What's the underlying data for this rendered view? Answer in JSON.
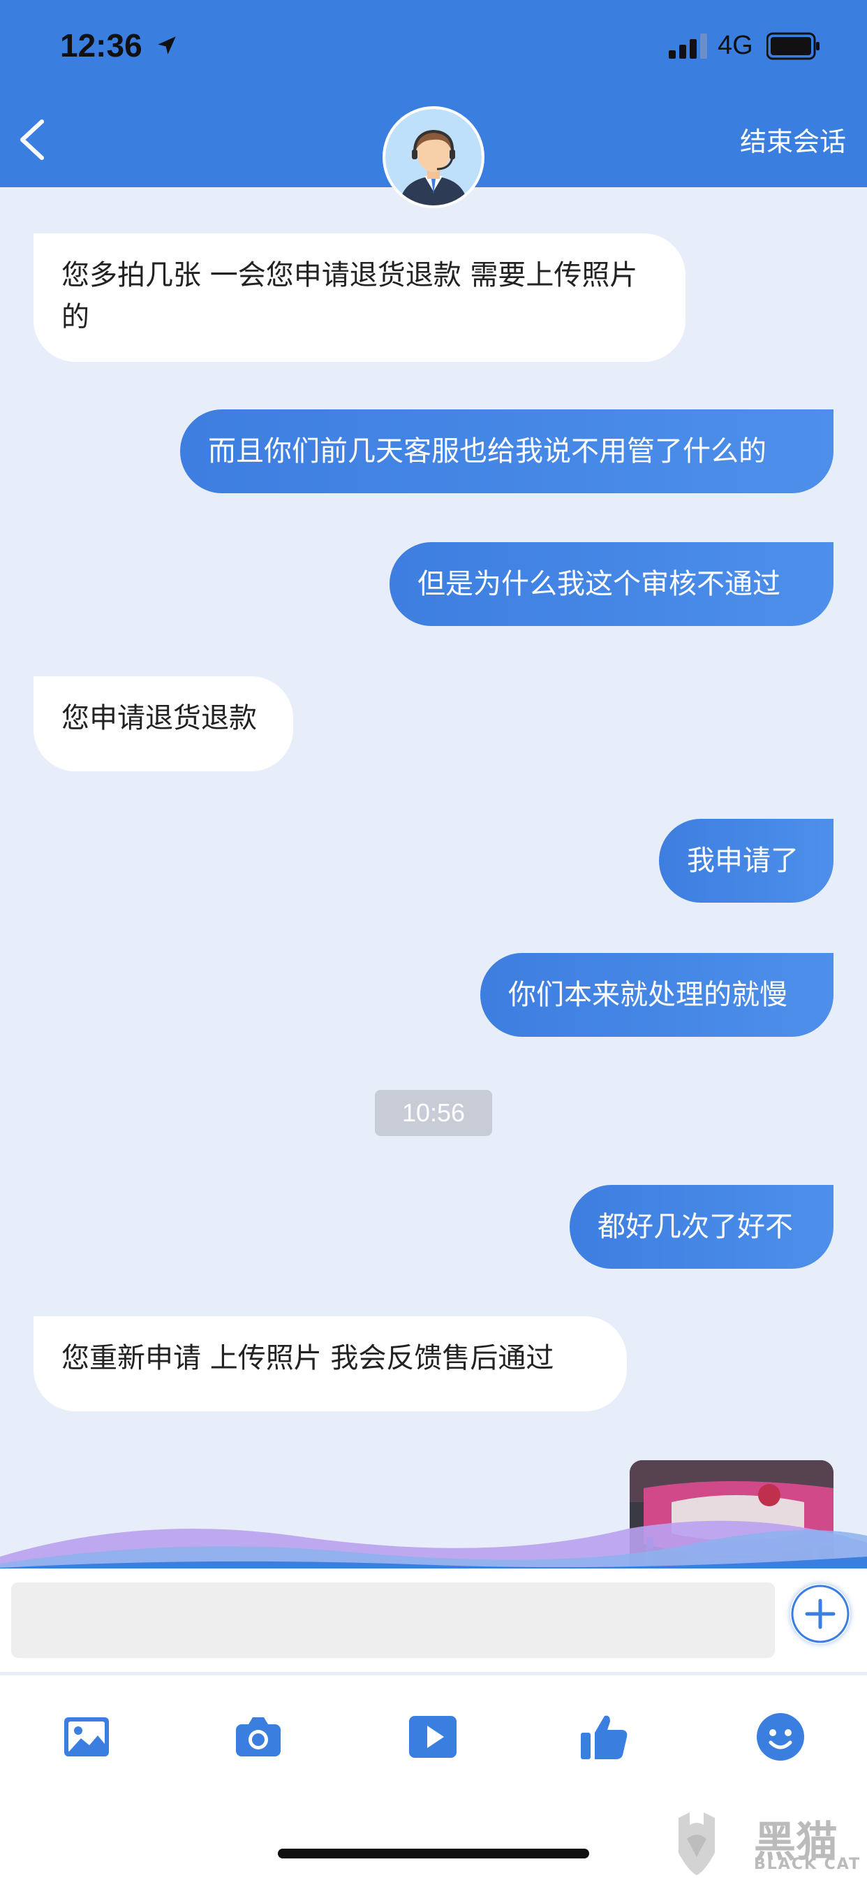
{
  "status_bar": {
    "time": "12:36",
    "network": "4G"
  },
  "header": {
    "end_session_label": "结束会话"
  },
  "messages": [
    {
      "side": "in",
      "text": "您多拍几张   一会您申请退货退款  需要上传照片的"
    },
    {
      "side": "out",
      "text": "而且你们前几天客服也给我说不用管了什么的"
    },
    {
      "side": "out",
      "text": "但是为什么我这个审核不通过"
    },
    {
      "side": "in",
      "text": "您申请退货退款"
    },
    {
      "side": "out",
      "text": "我申请了"
    },
    {
      "side": "out",
      "text": "你们本来就处理的就慢"
    },
    {
      "side": "out",
      "text": "都好几次了好不"
    },
    {
      "side": "in",
      "text": "您重新申请  上传照片   我会反馈售后通过"
    }
  ],
  "timestamp": "10:56",
  "input": {
    "value": "",
    "placeholder": ""
  },
  "toolbar": {
    "items": [
      {
        "icon": "image-icon"
      },
      {
        "icon": "camera-icon"
      },
      {
        "icon": "video-icon"
      },
      {
        "icon": "thumbs-up-icon"
      },
      {
        "icon": "emoji-icon"
      }
    ]
  },
  "watermark": {
    "cn": "黑猫",
    "en": "BLACK CAT"
  },
  "colors": {
    "accent": "#3a7fe0",
    "chat_bg": "#e8eef9",
    "bubble_in": "#ffffff"
  }
}
